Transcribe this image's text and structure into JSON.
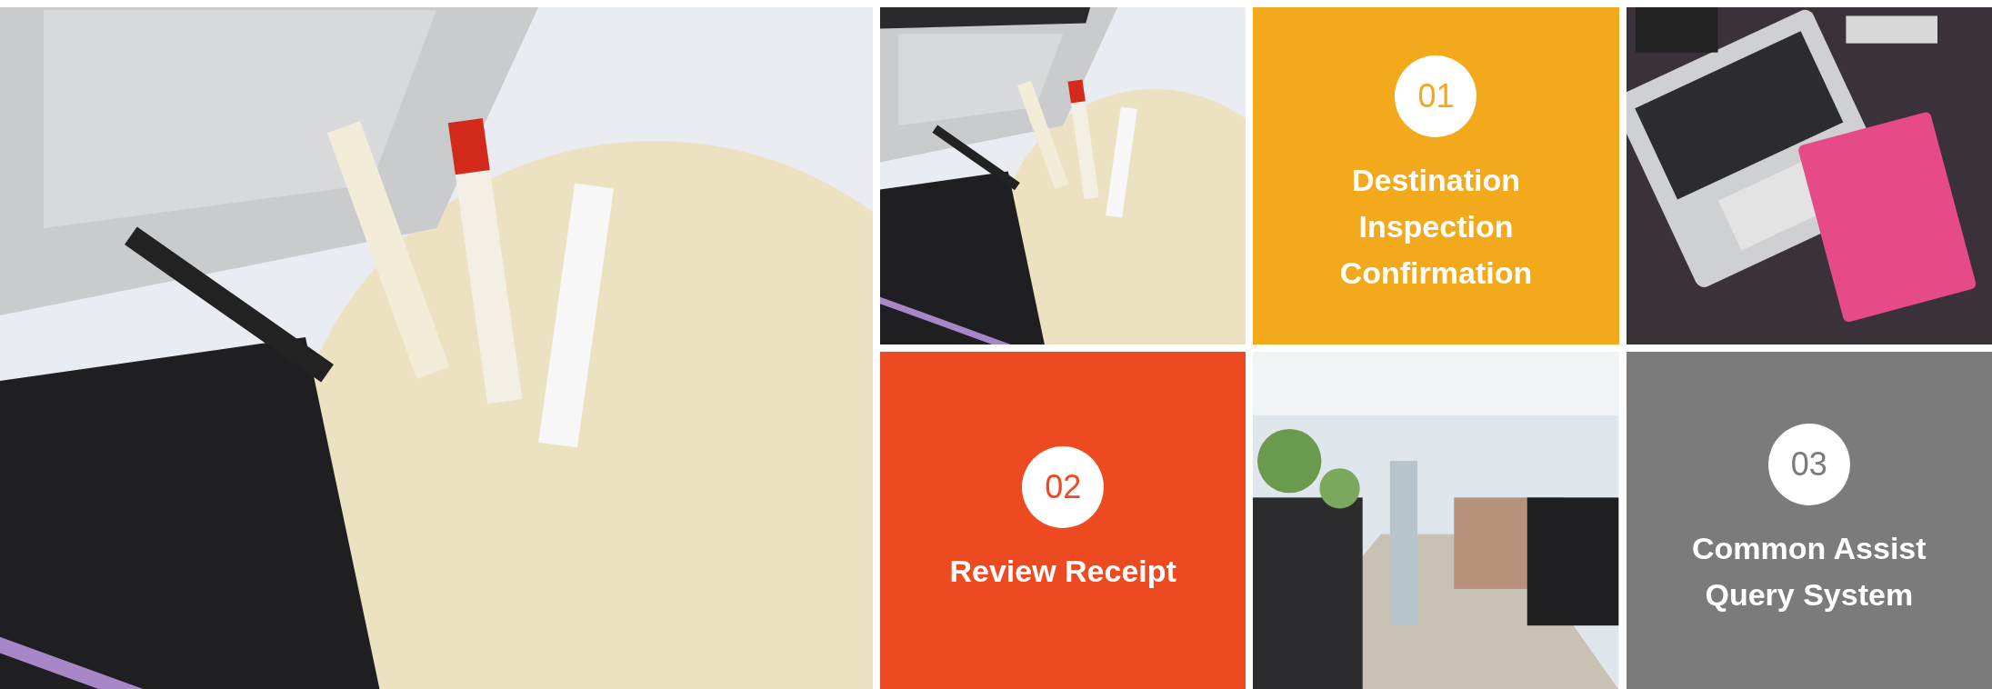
{
  "feature": {
    "kind": "picture"
  },
  "tiles": [
    {
      "kind": "picture"
    },
    {
      "kind": "step",
      "number": "01",
      "title": "Destination Inspection Confirmation",
      "color": "#f3a91c"
    },
    {
      "kind": "picture"
    },
    {
      "kind": "step",
      "number": "02",
      "title": "Review Receipt",
      "color": "#ee4a22"
    },
    {
      "kind": "picture"
    },
    {
      "kind": "step",
      "number": "03",
      "title": "Common Assist Query System",
      "color": "#7b7b7b"
    }
  ]
}
